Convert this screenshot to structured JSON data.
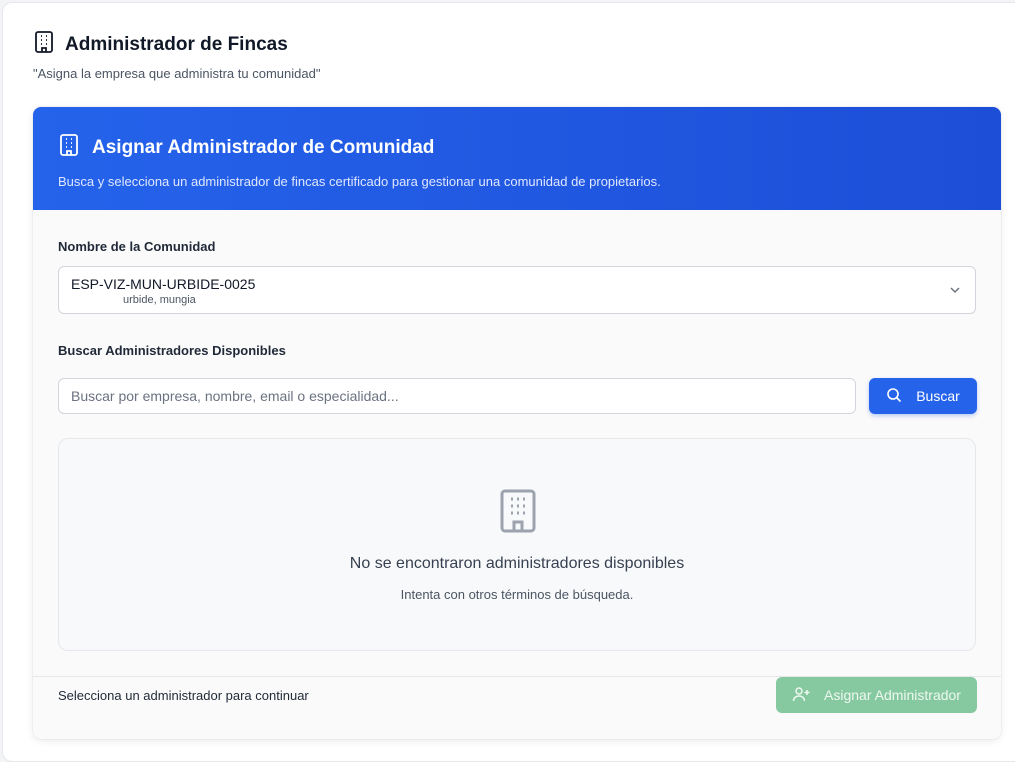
{
  "page": {
    "title": "Administrador de Fincas",
    "subtitle": "\"Asigna la empresa que administra tu comunidad\"",
    "title_icon": "building-icon"
  },
  "card": {
    "title": "Asignar Administrador de Comunidad",
    "description": "Busca y selecciona un administrador de fincas certificado para gestionar una comunidad de propietarios.",
    "header_color": "#2563eb"
  },
  "community": {
    "label": "Nombre de la Comunidad",
    "selected_value": "ESP-VIZ-MUN-URBIDE-0025",
    "selected_detail": "urbide, mungia"
  },
  "search": {
    "label": "Buscar Administradores Disponibles",
    "placeholder": "Buscar por empresa, nombre, email o especialidad...",
    "value": "",
    "button_label": "Buscar"
  },
  "empty_state": {
    "title": "No se encontraron administradores disponibles",
    "subtitle": "Intenta con otros términos de búsqueda.",
    "icon": "building-icon"
  },
  "footer": {
    "hint": "Selecciona un administrador para continuar",
    "assign_label": "Asignar Administrador",
    "assign_color": "#86c9a0"
  }
}
